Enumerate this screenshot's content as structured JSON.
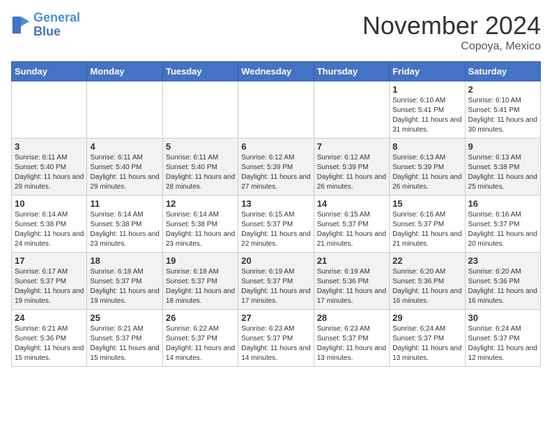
{
  "header": {
    "logo_line1": "General",
    "logo_line2": "Blue",
    "month": "November 2024",
    "location": "Copoya, Mexico"
  },
  "weekdays": [
    "Sunday",
    "Monday",
    "Tuesday",
    "Wednesday",
    "Thursday",
    "Friday",
    "Saturday"
  ],
  "weeks": [
    [
      {
        "day": "",
        "info": ""
      },
      {
        "day": "",
        "info": ""
      },
      {
        "day": "",
        "info": ""
      },
      {
        "day": "",
        "info": ""
      },
      {
        "day": "",
        "info": ""
      },
      {
        "day": "1",
        "info": "Sunrise: 6:10 AM\nSunset: 5:41 PM\nDaylight: 11 hours and 31 minutes."
      },
      {
        "day": "2",
        "info": "Sunrise: 6:10 AM\nSunset: 5:41 PM\nDaylight: 11 hours and 30 minutes."
      }
    ],
    [
      {
        "day": "3",
        "info": "Sunrise: 6:11 AM\nSunset: 5:40 PM\nDaylight: 11 hours and 29 minutes."
      },
      {
        "day": "4",
        "info": "Sunrise: 6:11 AM\nSunset: 5:40 PM\nDaylight: 11 hours and 29 minutes."
      },
      {
        "day": "5",
        "info": "Sunrise: 6:11 AM\nSunset: 5:40 PM\nDaylight: 11 hours and 28 minutes."
      },
      {
        "day": "6",
        "info": "Sunrise: 6:12 AM\nSunset: 5:39 PM\nDaylight: 11 hours and 27 minutes."
      },
      {
        "day": "7",
        "info": "Sunrise: 6:12 AM\nSunset: 5:39 PM\nDaylight: 11 hours and 26 minutes."
      },
      {
        "day": "8",
        "info": "Sunrise: 6:13 AM\nSunset: 5:39 PM\nDaylight: 11 hours and 26 minutes."
      },
      {
        "day": "9",
        "info": "Sunrise: 6:13 AM\nSunset: 5:38 PM\nDaylight: 11 hours and 25 minutes."
      }
    ],
    [
      {
        "day": "10",
        "info": "Sunrise: 6:14 AM\nSunset: 5:38 PM\nDaylight: 11 hours and 24 minutes."
      },
      {
        "day": "11",
        "info": "Sunrise: 6:14 AM\nSunset: 5:38 PM\nDaylight: 11 hours and 23 minutes."
      },
      {
        "day": "12",
        "info": "Sunrise: 6:14 AM\nSunset: 5:38 PM\nDaylight: 11 hours and 23 minutes."
      },
      {
        "day": "13",
        "info": "Sunrise: 6:15 AM\nSunset: 5:37 PM\nDaylight: 11 hours and 22 minutes."
      },
      {
        "day": "14",
        "info": "Sunrise: 6:15 AM\nSunset: 5:37 PM\nDaylight: 11 hours and 21 minutes."
      },
      {
        "day": "15",
        "info": "Sunrise: 6:16 AM\nSunset: 5:37 PM\nDaylight: 11 hours and 21 minutes."
      },
      {
        "day": "16",
        "info": "Sunrise: 6:16 AM\nSunset: 5:37 PM\nDaylight: 11 hours and 20 minutes."
      }
    ],
    [
      {
        "day": "17",
        "info": "Sunrise: 6:17 AM\nSunset: 5:37 PM\nDaylight: 11 hours and 19 minutes."
      },
      {
        "day": "18",
        "info": "Sunrise: 6:18 AM\nSunset: 5:37 PM\nDaylight: 11 hours and 19 minutes."
      },
      {
        "day": "19",
        "info": "Sunrise: 6:18 AM\nSunset: 5:37 PM\nDaylight: 11 hours and 18 minutes."
      },
      {
        "day": "20",
        "info": "Sunrise: 6:19 AM\nSunset: 5:37 PM\nDaylight: 11 hours and 17 minutes."
      },
      {
        "day": "21",
        "info": "Sunrise: 6:19 AM\nSunset: 5:36 PM\nDaylight: 11 hours and 17 minutes."
      },
      {
        "day": "22",
        "info": "Sunrise: 6:20 AM\nSunset: 5:36 PM\nDaylight: 11 hours and 16 minutes."
      },
      {
        "day": "23",
        "info": "Sunrise: 6:20 AM\nSunset: 5:36 PM\nDaylight: 11 hours and 16 minutes."
      }
    ],
    [
      {
        "day": "24",
        "info": "Sunrise: 6:21 AM\nSunset: 5:36 PM\nDaylight: 11 hours and 15 minutes."
      },
      {
        "day": "25",
        "info": "Sunrise: 6:21 AM\nSunset: 5:37 PM\nDaylight: 11 hours and 15 minutes."
      },
      {
        "day": "26",
        "info": "Sunrise: 6:22 AM\nSunset: 5:37 PM\nDaylight: 11 hours and 14 minutes."
      },
      {
        "day": "27",
        "info": "Sunrise: 6:23 AM\nSunset: 5:37 PM\nDaylight: 11 hours and 14 minutes."
      },
      {
        "day": "28",
        "info": "Sunrise: 6:23 AM\nSunset: 5:37 PM\nDaylight: 11 hours and 13 minutes."
      },
      {
        "day": "29",
        "info": "Sunrise: 6:24 AM\nSunset: 5:37 PM\nDaylight: 11 hours and 13 minutes."
      },
      {
        "day": "30",
        "info": "Sunrise: 6:24 AM\nSunset: 5:37 PM\nDaylight: 11 hours and 12 minutes."
      }
    ]
  ]
}
